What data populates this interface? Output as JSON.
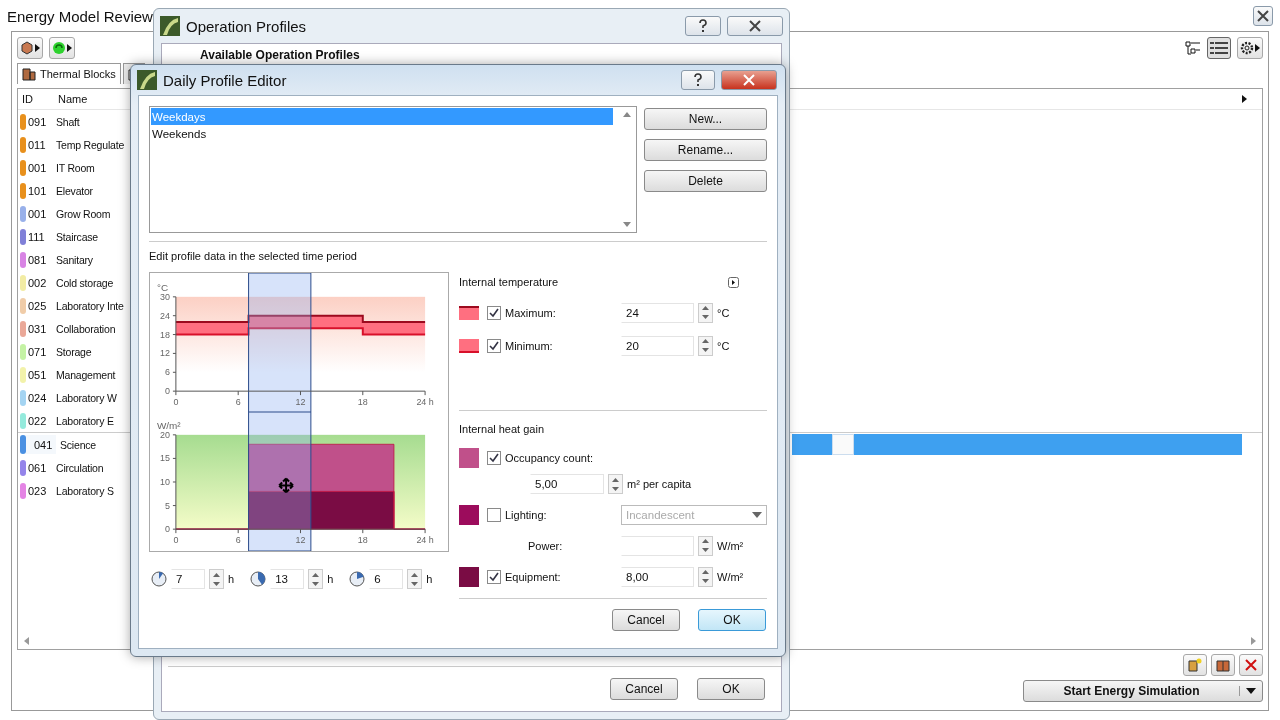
{
  "main_window": {
    "title": "Energy Model Review",
    "tab": {
      "label": "Thermal Blocks",
      "selected": true
    },
    "columns": [
      "ID",
      "Name"
    ],
    "blocks": [
      {
        "id": "091",
        "name": "Shaft",
        "color": "#e8901c",
        "selected": false
      },
      {
        "id": "011",
        "name": "Temp Regulate",
        "color": "#e8901c",
        "selected": false
      },
      {
        "id": "001",
        "name": "IT Room",
        "color": "#e8901c",
        "selected": false
      },
      {
        "id": "101",
        "name": "Elevator",
        "color": "#e8901c",
        "selected": false
      },
      {
        "id": "001",
        "name": "Grow Room",
        "color": "#98b0ea",
        "selected": false
      },
      {
        "id": "111",
        "name": "Staircase",
        "color": "#8080d8",
        "selected": false
      },
      {
        "id": "081",
        "name": "Sanitary",
        "color": "#d884e4",
        "selected": false
      },
      {
        "id": "002",
        "name": "Cold storage",
        "color": "#f2eca4",
        "selected": false
      },
      {
        "id": "025",
        "name": "Laboratory Inte",
        "color": "#f0cca8",
        "selected": false
      },
      {
        "id": "031",
        "name": "Collaboration",
        "color": "#eaa898",
        "selected": false
      },
      {
        "id": "071",
        "name": "Storage",
        "color": "#c4f2a4",
        "selected": false
      },
      {
        "id": "051",
        "name": "Management",
        "color": "#f2f2aa",
        "selected": false
      },
      {
        "id": "024",
        "name": "Laboratory W",
        "color": "#a4d4f2",
        "selected": false
      },
      {
        "id": "022",
        "name": "Laboratory E",
        "color": "#94eadc",
        "selected": false
      },
      {
        "id": "041",
        "name": "Science",
        "color": "#4a90e2",
        "selected": true
      },
      {
        "id": "061",
        "name": "Circulation",
        "color": "#9484ea",
        "selected": false
      },
      {
        "id": "023",
        "name": "Laboratory S",
        "color": "#e484e4",
        "selected": false
      }
    ],
    "start_button": "Start Energy Simulation"
  },
  "operation_profiles": {
    "title": "Operation Profiles",
    "header": "Available Operation Profiles",
    "buttons": [
      "Cancel",
      "OK"
    ]
  },
  "daily_profile_editor": {
    "title": "Daily Profile Editor",
    "profiles": [
      {
        "name": "Weekdays",
        "selected": true
      },
      {
        "name": "Weekends",
        "selected": false
      }
    ],
    "profile_buttons": [
      "New...",
      "Rename...",
      "Delete"
    ],
    "section_label": "Edit profile data in the selected time period",
    "temperature_chart": {
      "unit": "°C",
      "chart_data": {
        "type": "line",
        "x": [
          0,
          7,
          7,
          18,
          18,
          24
        ],
        "series": [
          {
            "color": "#9c0a1e",
            "values": [
              22,
              22,
              24,
              24,
              22,
              22
            ]
          },
          {
            "color": "#d8102a",
            "values": [
              18,
              18,
              20,
              20,
              18,
              18
            ]
          }
        ],
        "xlim": [
          0,
          24
        ],
        "ylim": [
          0,
          30
        ],
        "xticks": [
          0,
          6,
          12,
          18,
          {
            "value": 24,
            "label": "24 h"
          }
        ],
        "yticks": [
          0,
          6,
          12,
          18,
          24,
          30
        ]
      }
    },
    "heat_chart": {
      "unit": "W/m²",
      "chart_data": {
        "type": "area",
        "stacked": true,
        "x": [
          0,
          7,
          7,
          21,
          21,
          24
        ],
        "series": [
          {
            "color": "#7a0c44",
            "values": [
              0,
              0,
              8,
              8,
              0,
              0
            ]
          },
          {
            "color": "#c0508a",
            "values": [
              0,
              0,
              10,
              10,
              0,
              0
            ]
          }
        ],
        "xlim": [
          0,
          24
        ],
        "ylim": [
          0,
          20
        ],
        "xticks": [
          0,
          6,
          12,
          18,
          {
            "value": 24,
            "label": "24 h"
          }
        ],
        "yticks": [
          0,
          5,
          10,
          15,
          20
        ]
      }
    },
    "time_inputs": [
      {
        "value": "7",
        "unit": "h"
      },
      {
        "value": "13",
        "unit": "h"
      },
      {
        "value": "6",
        "unit": "h"
      }
    ],
    "temperature": {
      "title": "Internal temperature",
      "rows": [
        {
          "label": "Maximum:",
          "checked": true,
          "value": "24",
          "unit": "°C",
          "color": "#9c0a1e"
        },
        {
          "label": "Minimum:",
          "checked": true,
          "value": "20",
          "unit": "°C",
          "color": "#d8102a"
        }
      ]
    },
    "heat_gain": {
      "title": "Internal heat gain",
      "rows": [
        {
          "kind": "count",
          "label": "Occupancy count:",
          "checked": true,
          "color": "#c0508a",
          "value": "5,00",
          "unit": "m² per capita"
        },
        {
          "kind": "lighting",
          "label": "Lighting:",
          "checked": false,
          "color": "#9c0c5c",
          "select": "Incandescent",
          "power_label": "Power:",
          "unit": "W/m²"
        },
        {
          "kind": "power",
          "label": "Equipment:",
          "checked": true,
          "color": "#7a0c44",
          "value": "8,00",
          "unit": "W/m²"
        }
      ]
    },
    "buttons": [
      "Cancel",
      "OK"
    ]
  }
}
